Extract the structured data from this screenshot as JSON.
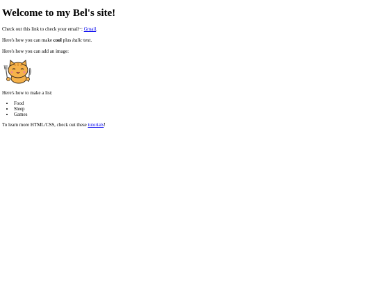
{
  "heading": "Welcome to my Bel's site!",
  "email_line": {
    "prefix": "Check out this link to check your email~: ",
    "link_text": "Gmail",
    "suffix": "."
  },
  "style_line": {
    "prefix": "Here's how you can make ",
    "bold_text": "cool",
    "middle": " plus ",
    "italic_text": "italic",
    "suffix": " text."
  },
  "image_line": "Here's how you can add an image:",
  "list_line": "Here's how to make a list:",
  "list_items": [
    "Food",
    "Sleep",
    "Games"
  ],
  "tutorial_line": {
    "prefix": "To learn more HTML/CSS, check out these ",
    "link_text": "tutorials",
    "suffix": "!"
  },
  "image": {
    "icon": "cartoon-cat-with-fork-and-knife",
    "colors": {
      "fur": "#f6b24a",
      "outline": "#3a2a1a",
      "cheek": "#f08a8a"
    }
  }
}
